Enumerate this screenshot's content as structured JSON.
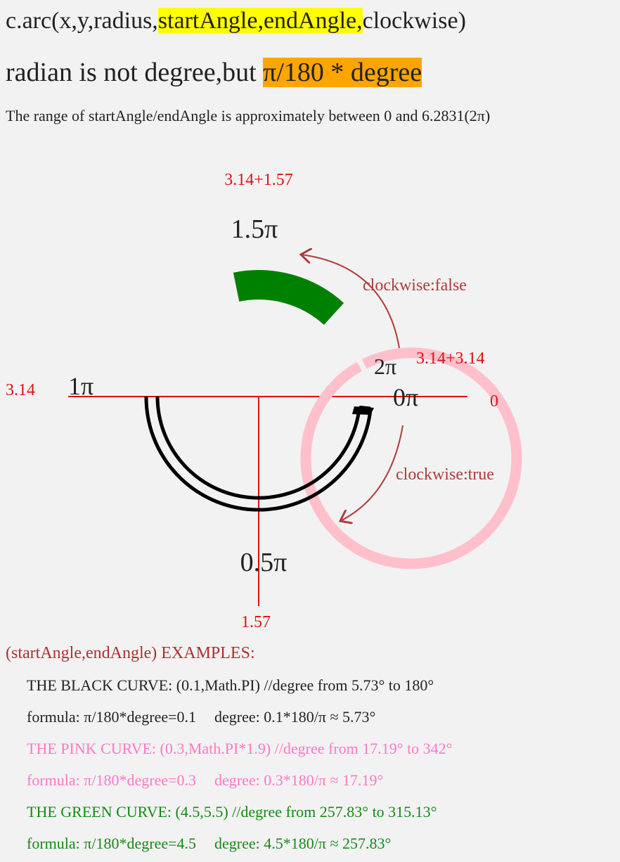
{
  "header": {
    "line1_a": "c.arc(x,y,radius,",
    "line1_b": "startAngle,endAngle,",
    "line1_c": "clockwise)",
    "line2_a": "radian is not degree,but ",
    "line2_b": "π/180 * degree",
    "line3": "The range of startAngle/endAngle is approximately between 0 and 6.2831(2π)"
  },
  "diagram": {
    "top_value": "3.14+1.57",
    "top_pi": "1.5π",
    "right_upper_pi": "2π",
    "right_upper_value": "3.14+3.14",
    "left_value": "3.14",
    "left_pi": "1π",
    "right_pi": "0π",
    "right_value": "0",
    "bottom_pi": "0.5π",
    "bottom_value": "1.57",
    "ccw_label": "clockwise:false",
    "cw_label": "clockwise:true",
    "colors": {
      "axis": "#e01010",
      "arrow": "#b03a3a",
      "black_curve": "#000000",
      "pink_curve": "#ffc0cb",
      "green_curve": "#008000"
    }
  },
  "examples": {
    "heading": "(startAngle,endAngle) EXAMPLES:",
    "black_title": "THE BLACK CURVE: (0.1,Math.PI) //degree from 5.73° to 180°",
    "black_formula": "formula: π/180*degree=0.1",
    "black_degree": "degree: 0.1*180/π ≈ 5.73°",
    "pink_title": "THE PINK CURVE: (0.3,Math.PI*1.9) //degree from 17.19° to 342°",
    "pink_formula": "formula: π/180*degree=0.3",
    "pink_degree": "degree: 0.3*180/π ≈ 17.19°",
    "green_title": "THE GREEN CURVE: (4.5,5.5) //degree from 257.83° to 315.13°",
    "green_formula": "formula: π/180*degree=4.5",
    "green_degree": "degree: 4.5*180/π ≈ 257.83°"
  }
}
